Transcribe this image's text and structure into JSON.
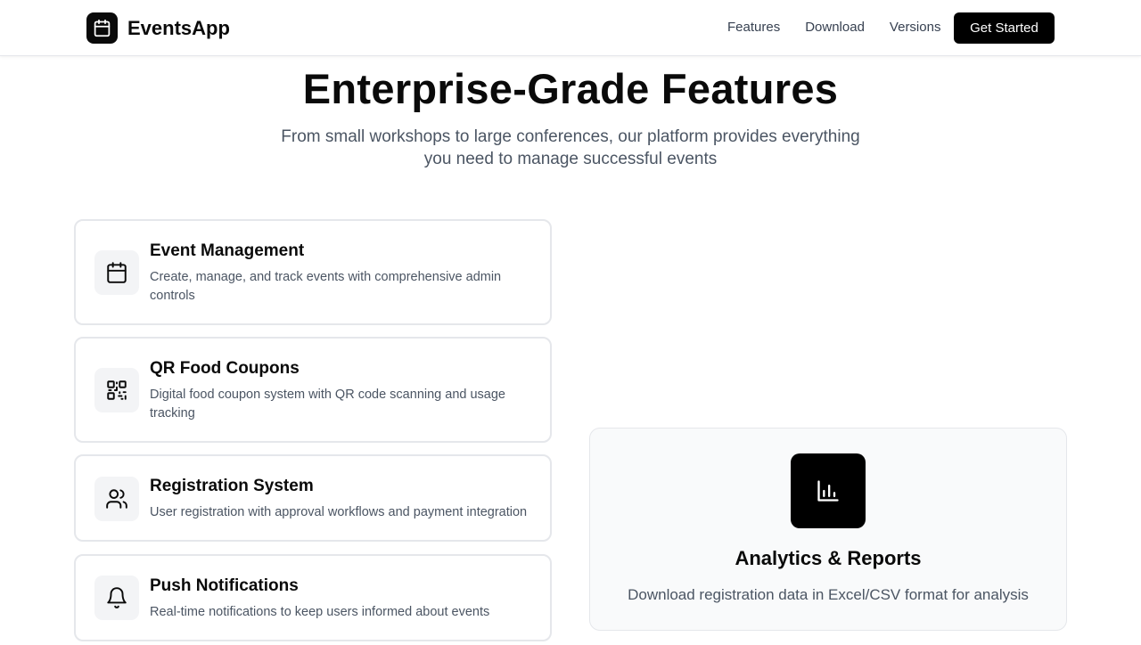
{
  "nav": {
    "brand": "EventsApp",
    "links": [
      "Features",
      "Download",
      "Versions"
    ],
    "cta": "Get Started"
  },
  "hero": {
    "title": "Enterprise-Grade Features",
    "subtitle": "From small workshops to large conferences, our platform provides everything you need to manage successful events"
  },
  "features": [
    {
      "icon": "calendar-icon",
      "title": "Event Management",
      "description": "Create, manage, and track events with comprehensive admin controls"
    },
    {
      "icon": "qr-code-icon",
      "title": "QR Food Coupons",
      "description": "Digital food coupon system with QR code scanning and usage tracking"
    },
    {
      "icon": "users-icon",
      "title": "Registration System",
      "description": "User registration with approval workflows and payment integration"
    },
    {
      "icon": "bell-icon",
      "title": "Push Notifications",
      "description": "Real-time notifications to keep users informed about events"
    }
  ],
  "analytics": {
    "icon": "bar-chart-icon",
    "title": "Analytics & Reports",
    "description": "Download registration data in Excel/CSV format for analysis"
  },
  "colors": {
    "primary": "#000000",
    "text": "#0a0a0a",
    "muted": "#4b5563",
    "border": "#e5e7eb",
    "icon_bg": "#f3f4f6",
    "panel_bg": "#f9fafb"
  }
}
